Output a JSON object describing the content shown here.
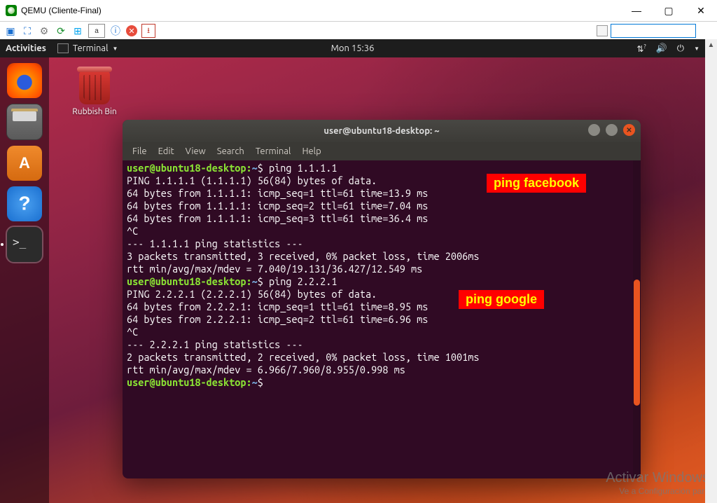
{
  "windows_title": "QEMU (Cliente-Final)",
  "gnome": {
    "activities": "Activities",
    "app_menu": "Terminal",
    "clock": "Mon 15:36"
  },
  "desktop_icon_label": "Rubbish Bin",
  "terminal": {
    "title": "user@ubuntu18-desktop: ~",
    "menus": [
      "File",
      "Edit",
      "View",
      "Search",
      "Terminal",
      "Help"
    ],
    "prompt_userhost": "user@ubuntu18-desktop",
    "prompt_path": "~",
    "lines": {
      "cmd1": "ping 1.1.1.1",
      "o1": "PING 1.1.1.1 (1.1.1.1) 56(84) bytes of data.",
      "o2": "64 bytes from 1.1.1.1: icmp_seq=1 ttl=61 time=13.9 ms",
      "o3": "64 bytes from 1.1.1.1: icmp_seq=2 ttl=61 time=7.04 ms",
      "o4": "64 bytes from 1.1.1.1: icmp_seq=3 ttl=61 time=36.4 ms",
      "o5": "^C",
      "o6": "--- 1.1.1.1 ping statistics ---",
      "o7": "3 packets transmitted, 3 received, 0% packet loss, time 2006ms",
      "o8": "rtt min/avg/max/mdev = 7.040/19.131/36.427/12.549 ms",
      "cmd2": "ping 2.2.2.1",
      "p1": "PING 2.2.2.1 (2.2.2.1) 56(84) bytes of data.",
      "p2": "64 bytes from 2.2.2.1: icmp_seq=1 ttl=61 time=8.95 ms",
      "p3": "64 bytes from 2.2.2.1: icmp_seq=2 ttl=61 time=6.96 ms",
      "p4": "^C",
      "p5": "--- 2.2.2.1 ping statistics ---",
      "p6": "2 packets transmitted, 2 received, 0% packet loss, time 1001ms",
      "p7": "rtt min/avg/max/mdev = 6.966/7.960/8.955/0.998 ms"
    }
  },
  "annotations": {
    "a1": "ping facebook",
    "a2": "ping google"
  },
  "watermark": {
    "l1": "Activar Windows",
    "l2": "Ve a Configuración para"
  }
}
